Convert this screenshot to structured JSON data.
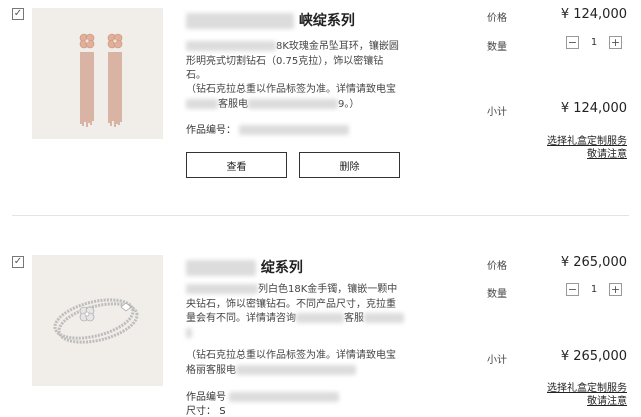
{
  "items": [
    {
      "checkbox_mark": "✓",
      "title": "峡绽系列",
      "description": [
        "8K玫瑰金吊坠耳环，镶嵌圆",
        "形明亮式切割钻石（0.75克拉），饰以密镶钻",
        "石。"
      ],
      "note": [
        "（钻石克拉总重以作品标签为准。详情请致电宝",
        "客服电",
        "9。）"
      ],
      "code_label": "作品编号：",
      "view_label": "查看",
      "delete_label": "删除",
      "price_label": "价格",
      "price": "¥ 124,000",
      "qty_label": "数量",
      "qty": "1",
      "subtotal_label": "小计",
      "subtotal": "¥ 124,000",
      "gift_link": "选择礼盒定制服务",
      "notice_link": "敬请注意"
    },
    {
      "checkbox_mark": "✓",
      "title": "绽系列",
      "description": [
        "列白色18K金手镯，镶嵌一颗中",
        "央钻石，饰以密镶钻石。不同产品尺寸，克拉重",
        "量会有不同。详情请咨询",
        "客服"
      ],
      "note": [
        "（钻石克拉总重以作品标签为准。详情请致电宝",
        "格丽客服电"
      ],
      "code_label": "作品编号",
      "size_label": "尺寸：",
      "size_value": "S",
      "price_label": "价格",
      "price": "¥ 265,000",
      "qty_label": "数量",
      "qty": "1",
      "subtotal_label": "小计",
      "subtotal": "¥ 265,000",
      "gift_link": "选择礼盒定制服务",
      "notice_link": "敬请注意"
    }
  ],
  "stepper": {
    "minus": "−",
    "plus": "+"
  },
  "colors": {
    "thumb_bg": "#f1ede8",
    "rose_gold": "#d9a58f",
    "silver": "#c9c9c9"
  }
}
